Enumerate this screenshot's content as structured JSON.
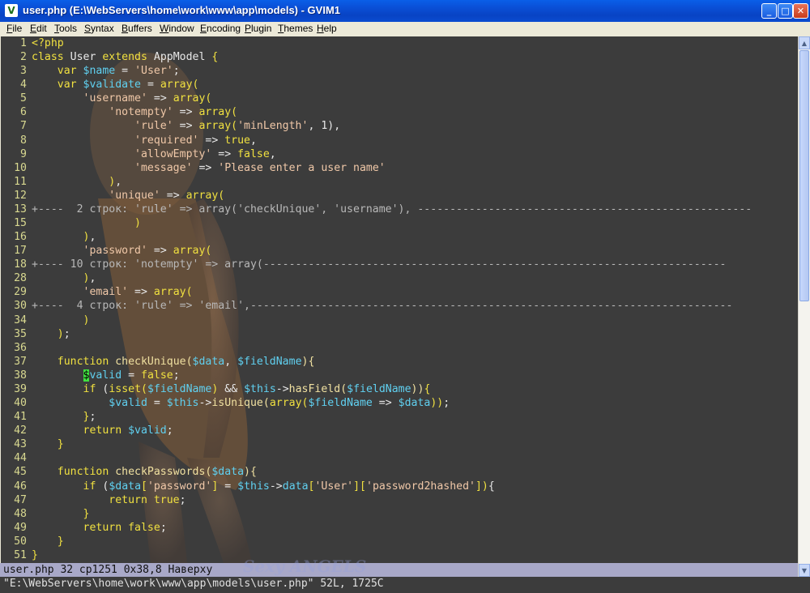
{
  "window": {
    "title": "user.php (E:\\WebServers\\home\\work\\www\\app\\models) - GVIM1",
    "app_icon_letter": "V",
    "buttons": {
      "minimize": "_",
      "maximize": "□",
      "close": "✕"
    }
  },
  "menu": [
    "File",
    "Edit",
    "Tools",
    "Syntax",
    "Buffers",
    "Window",
    "Encoding",
    "Plugin",
    "Themes",
    "Help"
  ],
  "editor": {
    "lines": [
      {
        "n": "1",
        "segs": [
          [
            "op",
            "<?php"
          ]
        ]
      },
      {
        "n": "2",
        "segs": [
          [
            "kw",
            "class "
          ],
          [
            "txt",
            "User "
          ],
          [
            "kw",
            "extends "
          ],
          [
            "txt",
            "AppModel "
          ],
          [
            "op",
            "{"
          ]
        ]
      },
      {
        "n": "3",
        "segs": [
          [
            "txt",
            "    "
          ],
          [
            "kw",
            "var "
          ],
          [
            "var",
            "$name"
          ],
          [
            "txt",
            " = "
          ],
          [
            "str",
            "'User'"
          ],
          [
            "txt",
            ";"
          ]
        ]
      },
      {
        "n": "4",
        "segs": [
          [
            "txt",
            "    "
          ],
          [
            "kw",
            "var "
          ],
          [
            "var",
            "$validate"
          ],
          [
            "txt",
            " = "
          ],
          [
            "kw",
            "array("
          ]
        ]
      },
      {
        "n": "5",
        "segs": [
          [
            "txt",
            "        "
          ],
          [
            "str",
            "'username'"
          ],
          [
            "txt",
            " => "
          ],
          [
            "kw",
            "array("
          ]
        ]
      },
      {
        "n": "6",
        "segs": [
          [
            "txt",
            "            "
          ],
          [
            "str",
            "'notempty'"
          ],
          [
            "txt",
            " => "
          ],
          [
            "kw",
            "array("
          ]
        ]
      },
      {
        "n": "7",
        "segs": [
          [
            "txt",
            "                "
          ],
          [
            "str",
            "'rule'"
          ],
          [
            "txt",
            " => "
          ],
          [
            "kw",
            "array("
          ],
          [
            "str",
            "'minLength'"
          ],
          [
            "txt",
            ", 1),"
          ]
        ]
      },
      {
        "n": "8",
        "segs": [
          [
            "txt",
            "                "
          ],
          [
            "str",
            "'required'"
          ],
          [
            "txt",
            " => "
          ],
          [
            "kw",
            "true"
          ],
          [
            "txt",
            ","
          ]
        ]
      },
      {
        "n": "9",
        "segs": [
          [
            "txt",
            "                "
          ],
          [
            "str",
            "'allowEmpty'"
          ],
          [
            "txt",
            " => "
          ],
          [
            "kw",
            "false"
          ],
          [
            "txt",
            ","
          ]
        ]
      },
      {
        "n": "10",
        "segs": [
          [
            "txt",
            "                "
          ],
          [
            "str",
            "'message'"
          ],
          [
            "txt",
            " => "
          ],
          [
            "str",
            "'Please enter a user name'"
          ]
        ]
      },
      {
        "n": "11",
        "segs": [
          [
            "txt",
            "            "
          ],
          [
            "kw",
            ")"
          ],
          [
            "txt",
            ","
          ]
        ]
      },
      {
        "n": "12",
        "segs": [
          [
            "txt",
            "            "
          ],
          [
            "str",
            "'unique'"
          ],
          [
            "txt",
            " => "
          ],
          [
            "kw",
            "array("
          ]
        ]
      },
      {
        "n": "13",
        "fold": true,
        "segs": [
          [
            "txt",
            "+----  2 строк: 'rule' => array('checkUnique', 'username'), ----------------------------------------------------"
          ]
        ]
      },
      {
        "n": "15",
        "segs": [
          [
            "txt",
            "                "
          ],
          [
            "kw",
            ")"
          ]
        ]
      },
      {
        "n": "16",
        "segs": [
          [
            "txt",
            "        "
          ],
          [
            "kw",
            ")"
          ],
          [
            "txt",
            ","
          ]
        ]
      },
      {
        "n": "17",
        "segs": [
          [
            "txt",
            "        "
          ],
          [
            "str",
            "'password'"
          ],
          [
            "txt",
            " => "
          ],
          [
            "kw",
            "array("
          ]
        ]
      },
      {
        "n": "18",
        "fold": true,
        "segs": [
          [
            "txt",
            "+---- 10 строк: 'notempty' => array(------------------------------------------------------------------------"
          ]
        ]
      },
      {
        "n": "28",
        "segs": [
          [
            "txt",
            "        "
          ],
          [
            "kw",
            ")"
          ],
          [
            "txt",
            ","
          ]
        ]
      },
      {
        "n": "29",
        "segs": [
          [
            "txt",
            "        "
          ],
          [
            "str",
            "'email'"
          ],
          [
            "txt",
            " => "
          ],
          [
            "kw",
            "array("
          ]
        ]
      },
      {
        "n": "30",
        "fold": true,
        "segs": [
          [
            "txt",
            "+----  4 строк: 'rule' => 'email',---------------------------------------------------------------------------"
          ]
        ]
      },
      {
        "n": "34",
        "segs": [
          [
            "txt",
            "        "
          ],
          [
            "kw",
            ")"
          ]
        ]
      },
      {
        "n": "35",
        "segs": [
          [
            "txt",
            "    "
          ],
          [
            "kw",
            ")"
          ],
          [
            "txt",
            ";"
          ]
        ]
      },
      {
        "n": "36",
        "segs": []
      },
      {
        "n": "37",
        "segs": [
          [
            "txt",
            "    "
          ],
          [
            "kw",
            "function "
          ],
          [
            "fn",
            "checkUnique("
          ],
          [
            "var",
            "$data"
          ],
          [
            "txt",
            ", "
          ],
          [
            "var",
            "$fieldName"
          ],
          [
            "fn",
            "){"
          ]
        ]
      },
      {
        "n": "38",
        "segs": [
          [
            "txt",
            "        "
          ],
          [
            "cursor",
            "$"
          ],
          [
            "var",
            "valid"
          ],
          [
            "txt",
            " = "
          ],
          [
            "kw",
            "false"
          ],
          [
            "txt",
            ";"
          ]
        ]
      },
      {
        "n": "39",
        "segs": [
          [
            "txt",
            "        "
          ],
          [
            "kw",
            "if "
          ],
          [
            "txt",
            "("
          ],
          [
            "kw",
            "isset("
          ],
          [
            "var",
            "$fieldName"
          ],
          [
            "kw",
            ")"
          ],
          [
            "txt",
            " && "
          ],
          [
            "var",
            "$this"
          ],
          [
            "txt",
            "->"
          ],
          [
            "fn",
            "hasField("
          ],
          [
            "var",
            "$fieldName"
          ],
          [
            "fn",
            "))"
          ],
          [
            "kw",
            "{"
          ]
        ]
      },
      {
        "n": "40",
        "segs": [
          [
            "txt",
            "            "
          ],
          [
            "var",
            "$valid"
          ],
          [
            "txt",
            " = "
          ],
          [
            "var",
            "$this"
          ],
          [
            "txt",
            "->"
          ],
          [
            "fn",
            "isUnique("
          ],
          [
            "kw",
            "array("
          ],
          [
            "var",
            "$fieldName"
          ],
          [
            "txt",
            " => "
          ],
          [
            "var",
            "$data"
          ],
          [
            "kw",
            "))"
          ],
          [
            "txt",
            ";"
          ]
        ]
      },
      {
        "n": "41",
        "segs": [
          [
            "txt",
            "        "
          ],
          [
            "kw",
            "}"
          ],
          [
            "txt",
            ";"
          ]
        ]
      },
      {
        "n": "42",
        "segs": [
          [
            "txt",
            "        "
          ],
          [
            "kw",
            "return "
          ],
          [
            "var",
            "$valid"
          ],
          [
            "txt",
            ";"
          ]
        ]
      },
      {
        "n": "43",
        "segs": [
          [
            "txt",
            "    "
          ],
          [
            "kw",
            "}"
          ]
        ]
      },
      {
        "n": "44",
        "segs": []
      },
      {
        "n": "45",
        "segs": [
          [
            "txt",
            "    "
          ],
          [
            "kw",
            "function "
          ],
          [
            "fn",
            "checkPasswords("
          ],
          [
            "var",
            "$data"
          ],
          [
            "fn",
            "){"
          ]
        ]
      },
      {
        "n": "46",
        "segs": [
          [
            "txt",
            "        "
          ],
          [
            "kw",
            "if "
          ],
          [
            "txt",
            "("
          ],
          [
            "var",
            "$data"
          ],
          [
            "kw",
            "["
          ],
          [
            "str",
            "'password'"
          ],
          [
            "kw",
            "]"
          ],
          [
            "txt",
            " = "
          ],
          [
            "var",
            "$this"
          ],
          [
            "txt",
            "->"
          ],
          [
            "var",
            "data"
          ],
          [
            "kw",
            "["
          ],
          [
            "str",
            "'User'"
          ],
          [
            "kw",
            "]["
          ],
          [
            "str",
            "'password2hashed'"
          ],
          [
            "kw",
            "])"
          ],
          [
            "txt",
            "{"
          ]
        ]
      },
      {
        "n": "47",
        "segs": [
          [
            "txt",
            "            "
          ],
          [
            "kw",
            "return "
          ],
          [
            "kw",
            "true"
          ],
          [
            "txt",
            ";"
          ]
        ]
      },
      {
        "n": "48",
        "segs": [
          [
            "txt",
            "        "
          ],
          [
            "kw",
            "}"
          ]
        ]
      },
      {
        "n": "49",
        "segs": [
          [
            "txt",
            "        "
          ],
          [
            "kw",
            "return "
          ],
          [
            "kw",
            "false"
          ],
          [
            "txt",
            ";"
          ]
        ]
      },
      {
        "n": "50",
        "segs": [
          [
            "txt",
            "    "
          ],
          [
            "kw",
            "}"
          ]
        ]
      },
      {
        "n": "51",
        "segs": [
          [
            "kw",
            "}"
          ]
        ]
      }
    ]
  },
  "statusline": "user.php 32 cp1251 0x38,8 Наверху",
  "cmdline": "\"E:\\WebServers\\home\\work\\www\\app\\models\\user.php\" 52L, 1725C",
  "watermark": "Sexy ANGELS",
  "scrollbar": {
    "up": "▲",
    "down": "▼"
  }
}
